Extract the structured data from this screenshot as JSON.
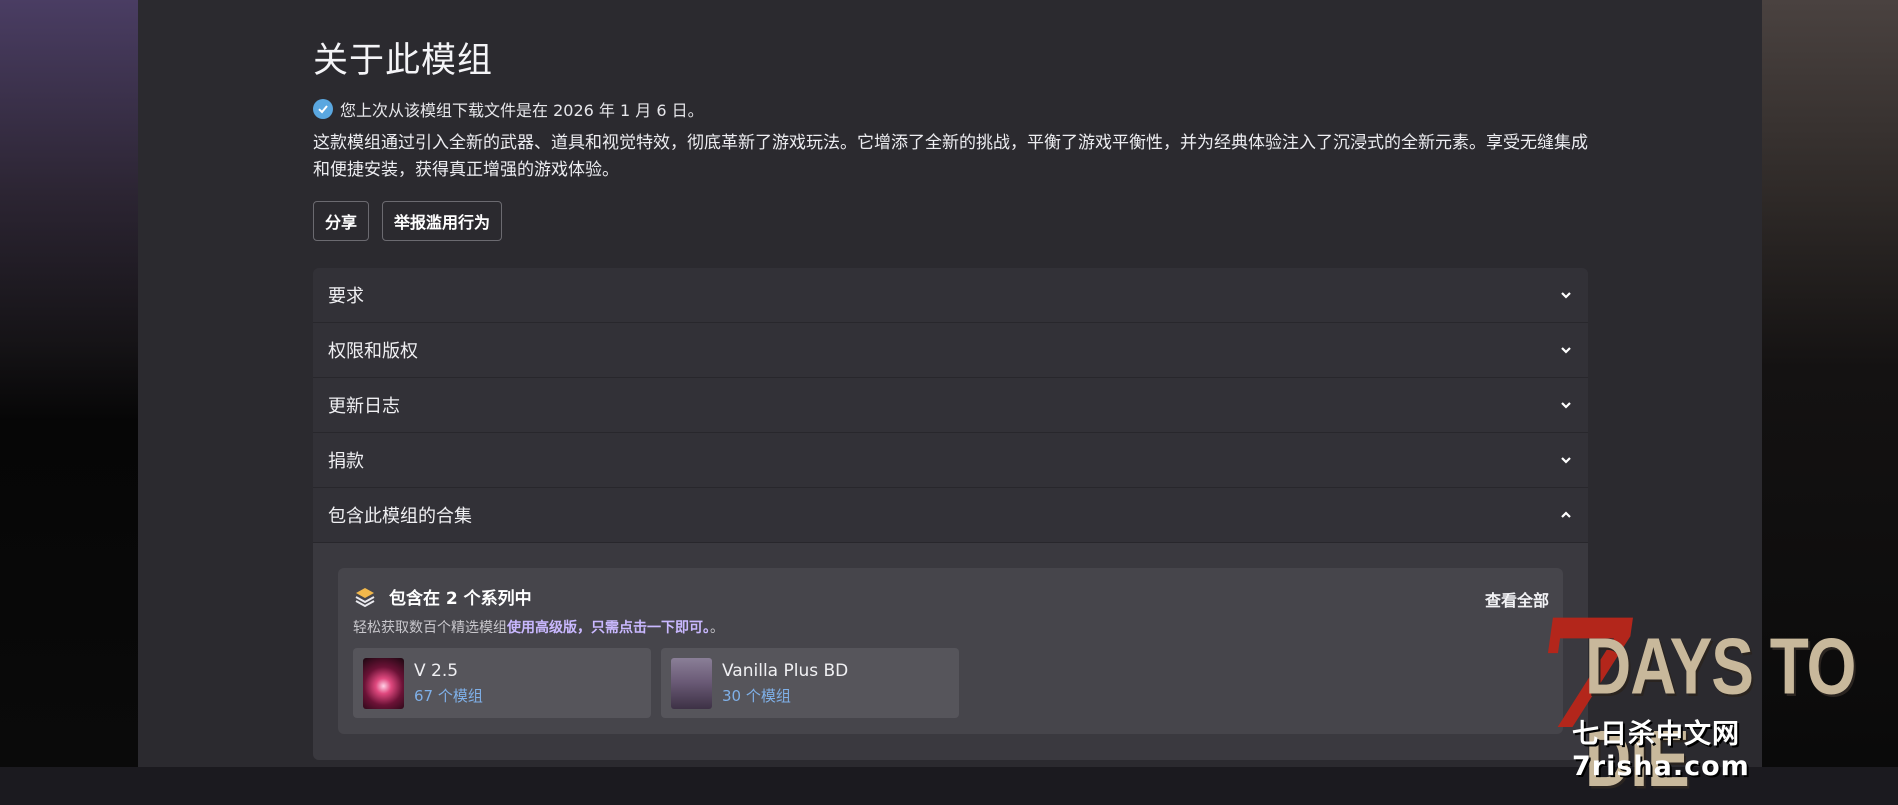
{
  "about": {
    "title": "关于此模组",
    "last_download": "您上次从该模组下载文件是在 2026 年 1 月 6 日。",
    "description": "这款模组通过引入全新的武器、道具和视觉特效，彻底革新了游戏玩法。它增添了全新的挑战，平衡了游戏平衡性，并为经典体验注入了沉浸式的全新元素。享受无缝集成和便捷安装，获得真正增强的游戏体验。"
  },
  "buttons": {
    "share": "分享",
    "report": "举报滥用行为"
  },
  "accordion": [
    {
      "label": "要求",
      "expanded": false
    },
    {
      "label": "权限和版权",
      "expanded": false
    },
    {
      "label": "更新日志",
      "expanded": false
    },
    {
      "label": "捐款",
      "expanded": false
    },
    {
      "label": "包含此模组的合集",
      "expanded": true
    }
  ],
  "collections": {
    "heading": "包含在 2 个系列中",
    "view_all": "查看全部",
    "sub_prefix": "轻松获取数百个精选模组",
    "sub_highlight": "使用高级版，只需点击一下即可。",
    "sub_suffix": "。",
    "items": [
      {
        "name": "V 2.5",
        "count": "67 个模组"
      },
      {
        "name": "Vanilla Plus BD",
        "count": "30 个模组"
      }
    ]
  },
  "watermark": {
    "title": "DAYS TO DIE",
    "numeral": "7",
    "subtitle": "七日杀中文网7risha.com"
  },
  "colors": {
    "accent_link": "#7fb0e8",
    "premium_highlight": "#c9b8ff",
    "check": "#5aa7e0"
  }
}
